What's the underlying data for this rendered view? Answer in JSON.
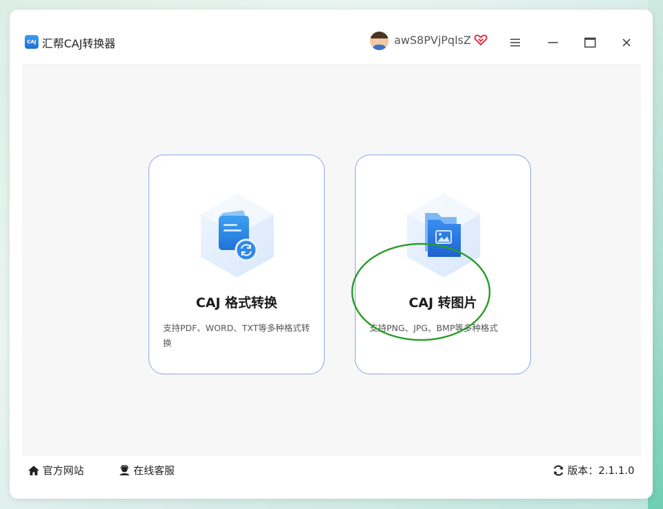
{
  "app": {
    "title": "汇帮CAJ转换器",
    "logo_text": "CAJ",
    "accent_color": "#1f6fd6"
  },
  "user": {
    "name": "awS8PVjPqlsZ",
    "vip_icon": "heart-vip-icon",
    "vip_color": "#e02a3c"
  },
  "window_controls": {
    "menu_icon": "hamburger-menu-icon",
    "minimize_icon": "minimize-icon",
    "maximize_icon": "maximize-icon",
    "close_icon": "close-icon"
  },
  "cards": [
    {
      "title": "CAJ 格式转换",
      "description": "支持PDF、WORD、TXT等多种格式转换",
      "icon": "document-convert-icon"
    },
    {
      "title": "CAJ 转图片",
      "description": "支持PNG、JPG、BMP等多种格式",
      "icon": "image-folder-icon"
    }
  ],
  "annotation": {
    "color": "#2a9d2a"
  },
  "footer": {
    "site_label": "官方网站",
    "service_label": "在线客服",
    "version_label": "版本：2.1.1.0"
  }
}
